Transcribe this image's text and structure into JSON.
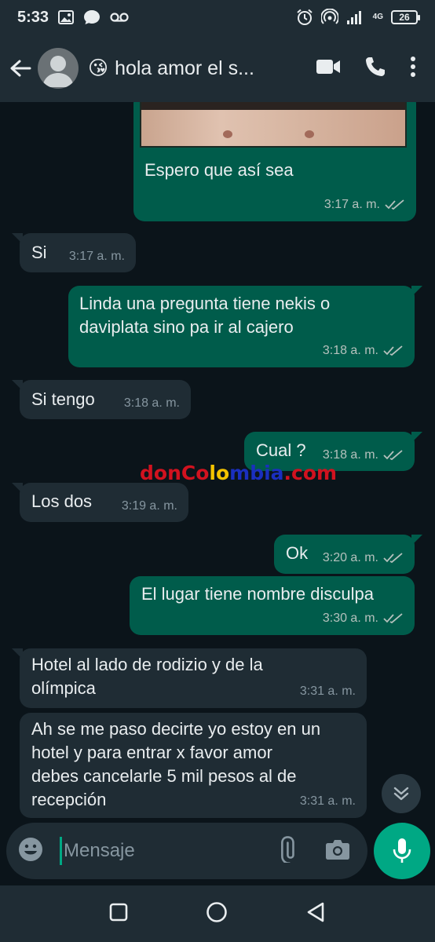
{
  "status_bar": {
    "time": "5:33",
    "network": "4G",
    "battery": "26"
  },
  "header": {
    "title": "hola amor el s...",
    "title_emoji": "😘"
  },
  "messages": [
    {
      "dir": "out",
      "text": "Espero que así sea",
      "time": "3:17 a. m."
    },
    {
      "dir": "in",
      "text": "Si",
      "time": "3:17 a. m."
    },
    {
      "dir": "out",
      "text": "Linda una pregunta tiene nekis o daviplata sino pa ir al cajero",
      "line1": "Linda una pregunta tiene nekis o",
      "line2": "daviplata sino pa ir al cajero",
      "time": "3:18 a. m."
    },
    {
      "dir": "in",
      "text": "Si tengo",
      "time": "3:18 a. m."
    },
    {
      "dir": "out",
      "text": "Cual ?",
      "time": "3:18 a. m."
    },
    {
      "dir": "in",
      "text": "Los dos",
      "time": "3:19 a. m."
    },
    {
      "dir": "out",
      "text": "Ok",
      "time": "3:20 a. m."
    },
    {
      "dir": "out",
      "text": "El lugar tiene nombre disculpa",
      "time": "3:30 a. m."
    },
    {
      "dir": "in",
      "line1": "Hotel al lado de rodizio y de la",
      "line2": "olímpica",
      "time": "3:31 a. m."
    },
    {
      "dir": "in",
      "line1": "Ah se me paso decirte yo estoy en un",
      "line2": "hotel y para entrar x favor amor",
      "line3": "debes cancelarle 5 mil pesos al de",
      "line4": "recepción",
      "time": "3:31 a. m."
    }
  ],
  "watermark": {
    "part1": "donCo",
    "part2": "lo",
    "part3": "mbia",
    "part4": ".com",
    "color1": "#d1121f",
    "color2": "#f5c400",
    "color3": "#1a2fbf",
    "color4": "#d1121f"
  },
  "input": {
    "placeholder": "Mensaje"
  },
  "colors": {
    "accent": "#00a884",
    "outgoing": "#005c4b",
    "incoming": "#1f2c34",
    "background": "#0b141a",
    "read_ticks": "#b5c1bd"
  },
  "icons": {
    "back": "arrow-left-icon",
    "video": "video-camera-icon",
    "call": "phone-icon",
    "menu": "more-vertical-icon",
    "emoji": "emoji-icon",
    "attach": "paperclip-icon",
    "camera": "camera-icon",
    "mic": "microphone-icon",
    "scroll": "double-chevron-down-icon"
  }
}
